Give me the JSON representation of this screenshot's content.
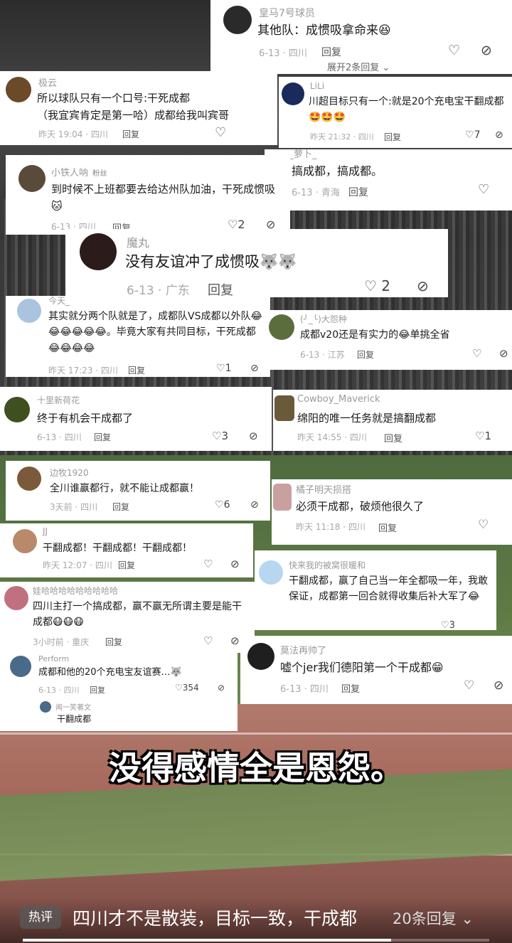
{
  "comments": [
    {
      "user": "皇马7号球员",
      "text": "其他队：成惯吸拿命来😆",
      "date": "6-13",
      "loc": "四川",
      "reply": "回复",
      "expand": "展开2条回复"
    },
    {
      "user": "极云",
      "text": "所以球队只有一个口号:干死成都\n（我宜宾肯定是第一哈）成都给我叫宾哥",
      "date": "昨天 19:04",
      "loc": "四川",
      "reply": "回复"
    },
    {
      "user": "LiLi",
      "text": "川超目标只有一个:就是20个充电宝干翻成都",
      "emoji": "🤩🤩🤩",
      "date": "昨天 21:32",
      "loc": "四川",
      "reply": "回复",
      "likes": "7"
    },
    {
      "user": "__萝卜_",
      "text": "搞成都，搞成都。",
      "date": "6-13",
      "loc": "青海",
      "reply": "回复"
    },
    {
      "user": "小铁人呐",
      "badge": "粉丝",
      "text": "到时候不上班都要去给达州队加油，干死成惯吸🐱",
      "date": "6-13",
      "loc": "四川",
      "reply": "回复",
      "likes": "2"
    },
    {
      "user": "魔丸",
      "text": "没有友谊冲了成惯吸🐺🐺",
      "date": "6-13",
      "loc": "广东",
      "reply": "回复",
      "likes": "2"
    },
    {
      "user": "今天_",
      "text": "其实就分两个队就是了，成都队VS成都以外队😂😂😂😂😂😂。毕竟大家有共同目标，干死成都😂😂😂😂",
      "date": "昨天 17:23",
      "loc": "四川",
      "reply": "回复",
      "likes": "1"
    },
    {
      "user": "(╯_╰)大怨种",
      "text": "成都v20还是有实力的😂单挑全省",
      "date": "6-13",
      "loc": "江苏",
      "reply": "回复"
    },
    {
      "user": "十里新荷花",
      "text": "终于有机会干成都了",
      "date": "6-13",
      "loc": "四川",
      "reply": "回复",
      "likes": "3"
    },
    {
      "user": "Cowboy_Maverick",
      "text": "绵阳的唯一任务就是搞翻成都",
      "date": "昨天 14:55",
      "loc": "四川",
      "reply": "回复",
      "likes": "1"
    },
    {
      "user": "边牧1920",
      "text": "全川谁赢都行，就不能让成都赢！",
      "date": "3天前",
      "loc": "四川",
      "reply": "回复",
      "likes": "6"
    },
    {
      "user": "橘子明天损搭",
      "text": "必须干成都，破烦他很久了",
      "date": "昨天 11:18",
      "loc": "四川",
      "reply": "回复"
    },
    {
      "user": "JJ",
      "text": "干翻成都！干翻成都！干翻成都！",
      "date": "昨天 12:07",
      "loc": "四川",
      "reply": "回复"
    },
    {
      "user": "快来我的被窝很暖和",
      "text": "干翻成都，赢了自己当一年全都吸一年，我敢保证，成都第一回合就得收集后补大军了😂",
      "date": "",
      "loc": "",
      "reply": "",
      "likes": "3"
    },
    {
      "user": "娃哈哈哈哈哈哈哈哈哈",
      "text": "四川主打一个搞成都，赢不赢无所谓主要是能干成都😷😷😷",
      "date": "3小时前",
      "loc": "重庆",
      "reply": "回复"
    },
    {
      "user": "莫法再帅了",
      "text": "嘘个jer我们德阳第一个干成都😁",
      "date": "6-13",
      "loc": "四川",
      "reply": "回复"
    },
    {
      "user": "Perform",
      "text": "成都和他的20个充电宝友谊赛…🐺",
      "date": "6-13",
      "loc": "四川",
      "reply": "回复",
      "likes": "354"
    },
    {
      "user": "闻一笑著文",
      "text": "干翻成都"
    }
  ],
  "caption": "没得感情全是恩怨。",
  "hot": {
    "tag": "热评",
    "text": "四川才不是散装，目标一致，干成都",
    "replies": "20条回复"
  },
  "progress": 0.79
}
